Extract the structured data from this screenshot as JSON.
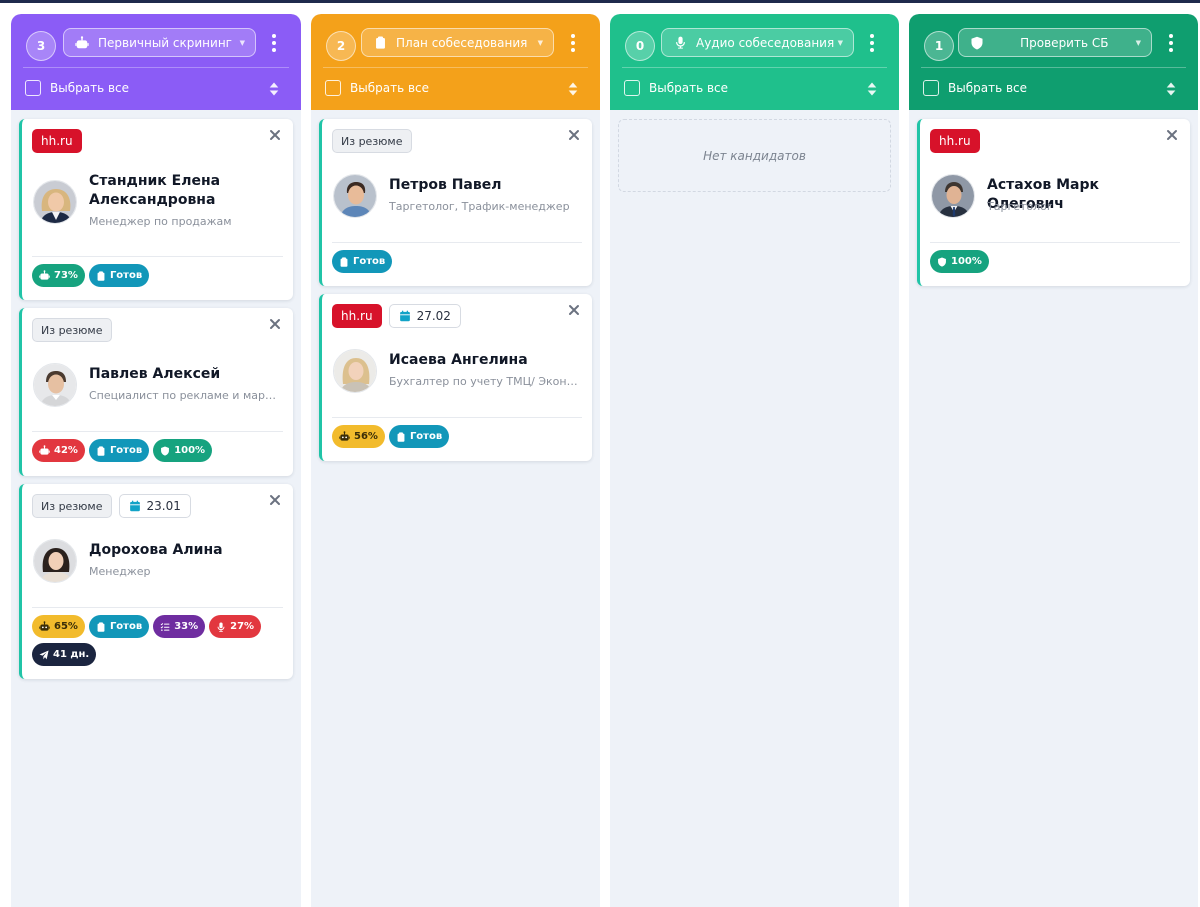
{
  "select_all_label": "Выбрать все",
  "hh_label": "hh.ru",
  "resume_label": "Из резюме",
  "colors": {
    "purple": "#8b5cf6",
    "orange": "#f4a11a",
    "green": "#1fc08c",
    "teal": "#0f9e6f",
    "card_accent": "#20c4a7"
  },
  "columns": [
    {
      "count": "3",
      "stage": "Первичный скрининг",
      "icon": "robot-icon",
      "cards": [
        {
          "name": "Стандник Елена Александровна",
          "role": "Менеджер по продажам",
          "source": "hh.ru",
          "badges": [
            {
              "icon": "robot-icon",
              "text": "73%"
            },
            {
              "icon": "clipboard-icon",
              "text": "Готов"
            }
          ]
        },
        {
          "name": "Павлев Алексей",
          "role": "Специалист по рекламе и маркетингу",
          "source": "Из резюме",
          "badges": [
            {
              "icon": "robot-icon",
              "text": "42%"
            },
            {
              "icon": "clipboard-icon",
              "text": "Готов"
            },
            {
              "icon": "shield-icon",
              "text": "100%"
            }
          ]
        },
        {
          "name": "Дорохова Алина",
          "role": "Менеджер",
          "source": "Из резюме",
          "date": "23.01",
          "badges": [
            {
              "icon": "robot-icon",
              "text": "65%"
            },
            {
              "icon": "clipboard-icon",
              "text": "Готов"
            },
            {
              "icon": "checklist-icon",
              "text": "33%"
            },
            {
              "icon": "microphone-icon",
              "text": "27%"
            },
            {
              "icon": "send-icon",
              "text": "41 дн."
            }
          ]
        }
      ]
    },
    {
      "count": "2",
      "stage": "План собеседования",
      "icon": "clipboard-icon",
      "cards": [
        {
          "name": "Петров Павел",
          "role": "Таргетолог, Трафик-менеджер",
          "source": "Из резюме",
          "badges": [
            {
              "icon": "clipboard-icon",
              "text": "Готов"
            }
          ]
        },
        {
          "name": "Исаева Ангелина",
          "role": "Бухгалтер по учету ТМЦ/ Экономист",
          "source": "hh.ru",
          "date": "27.02",
          "badges": [
            {
              "icon": "robot-icon",
              "text": "56%"
            },
            {
              "icon": "clipboard-icon",
              "text": "Готов"
            }
          ]
        }
      ]
    },
    {
      "count": "0",
      "stage": "Аудио собеседования",
      "icon": "microphone-icon",
      "empty_text": "Нет кандидатов"
    },
    {
      "count": "1",
      "stage": "Проверить СБ",
      "icon": "shield-icon",
      "cards": [
        {
          "name": "Астахов Марк Олегович",
          "role": "Таргетолог",
          "source": "hh.ru",
          "badges": [
            {
              "icon": "shield-icon",
              "text": "100%"
            }
          ]
        }
      ]
    }
  ]
}
